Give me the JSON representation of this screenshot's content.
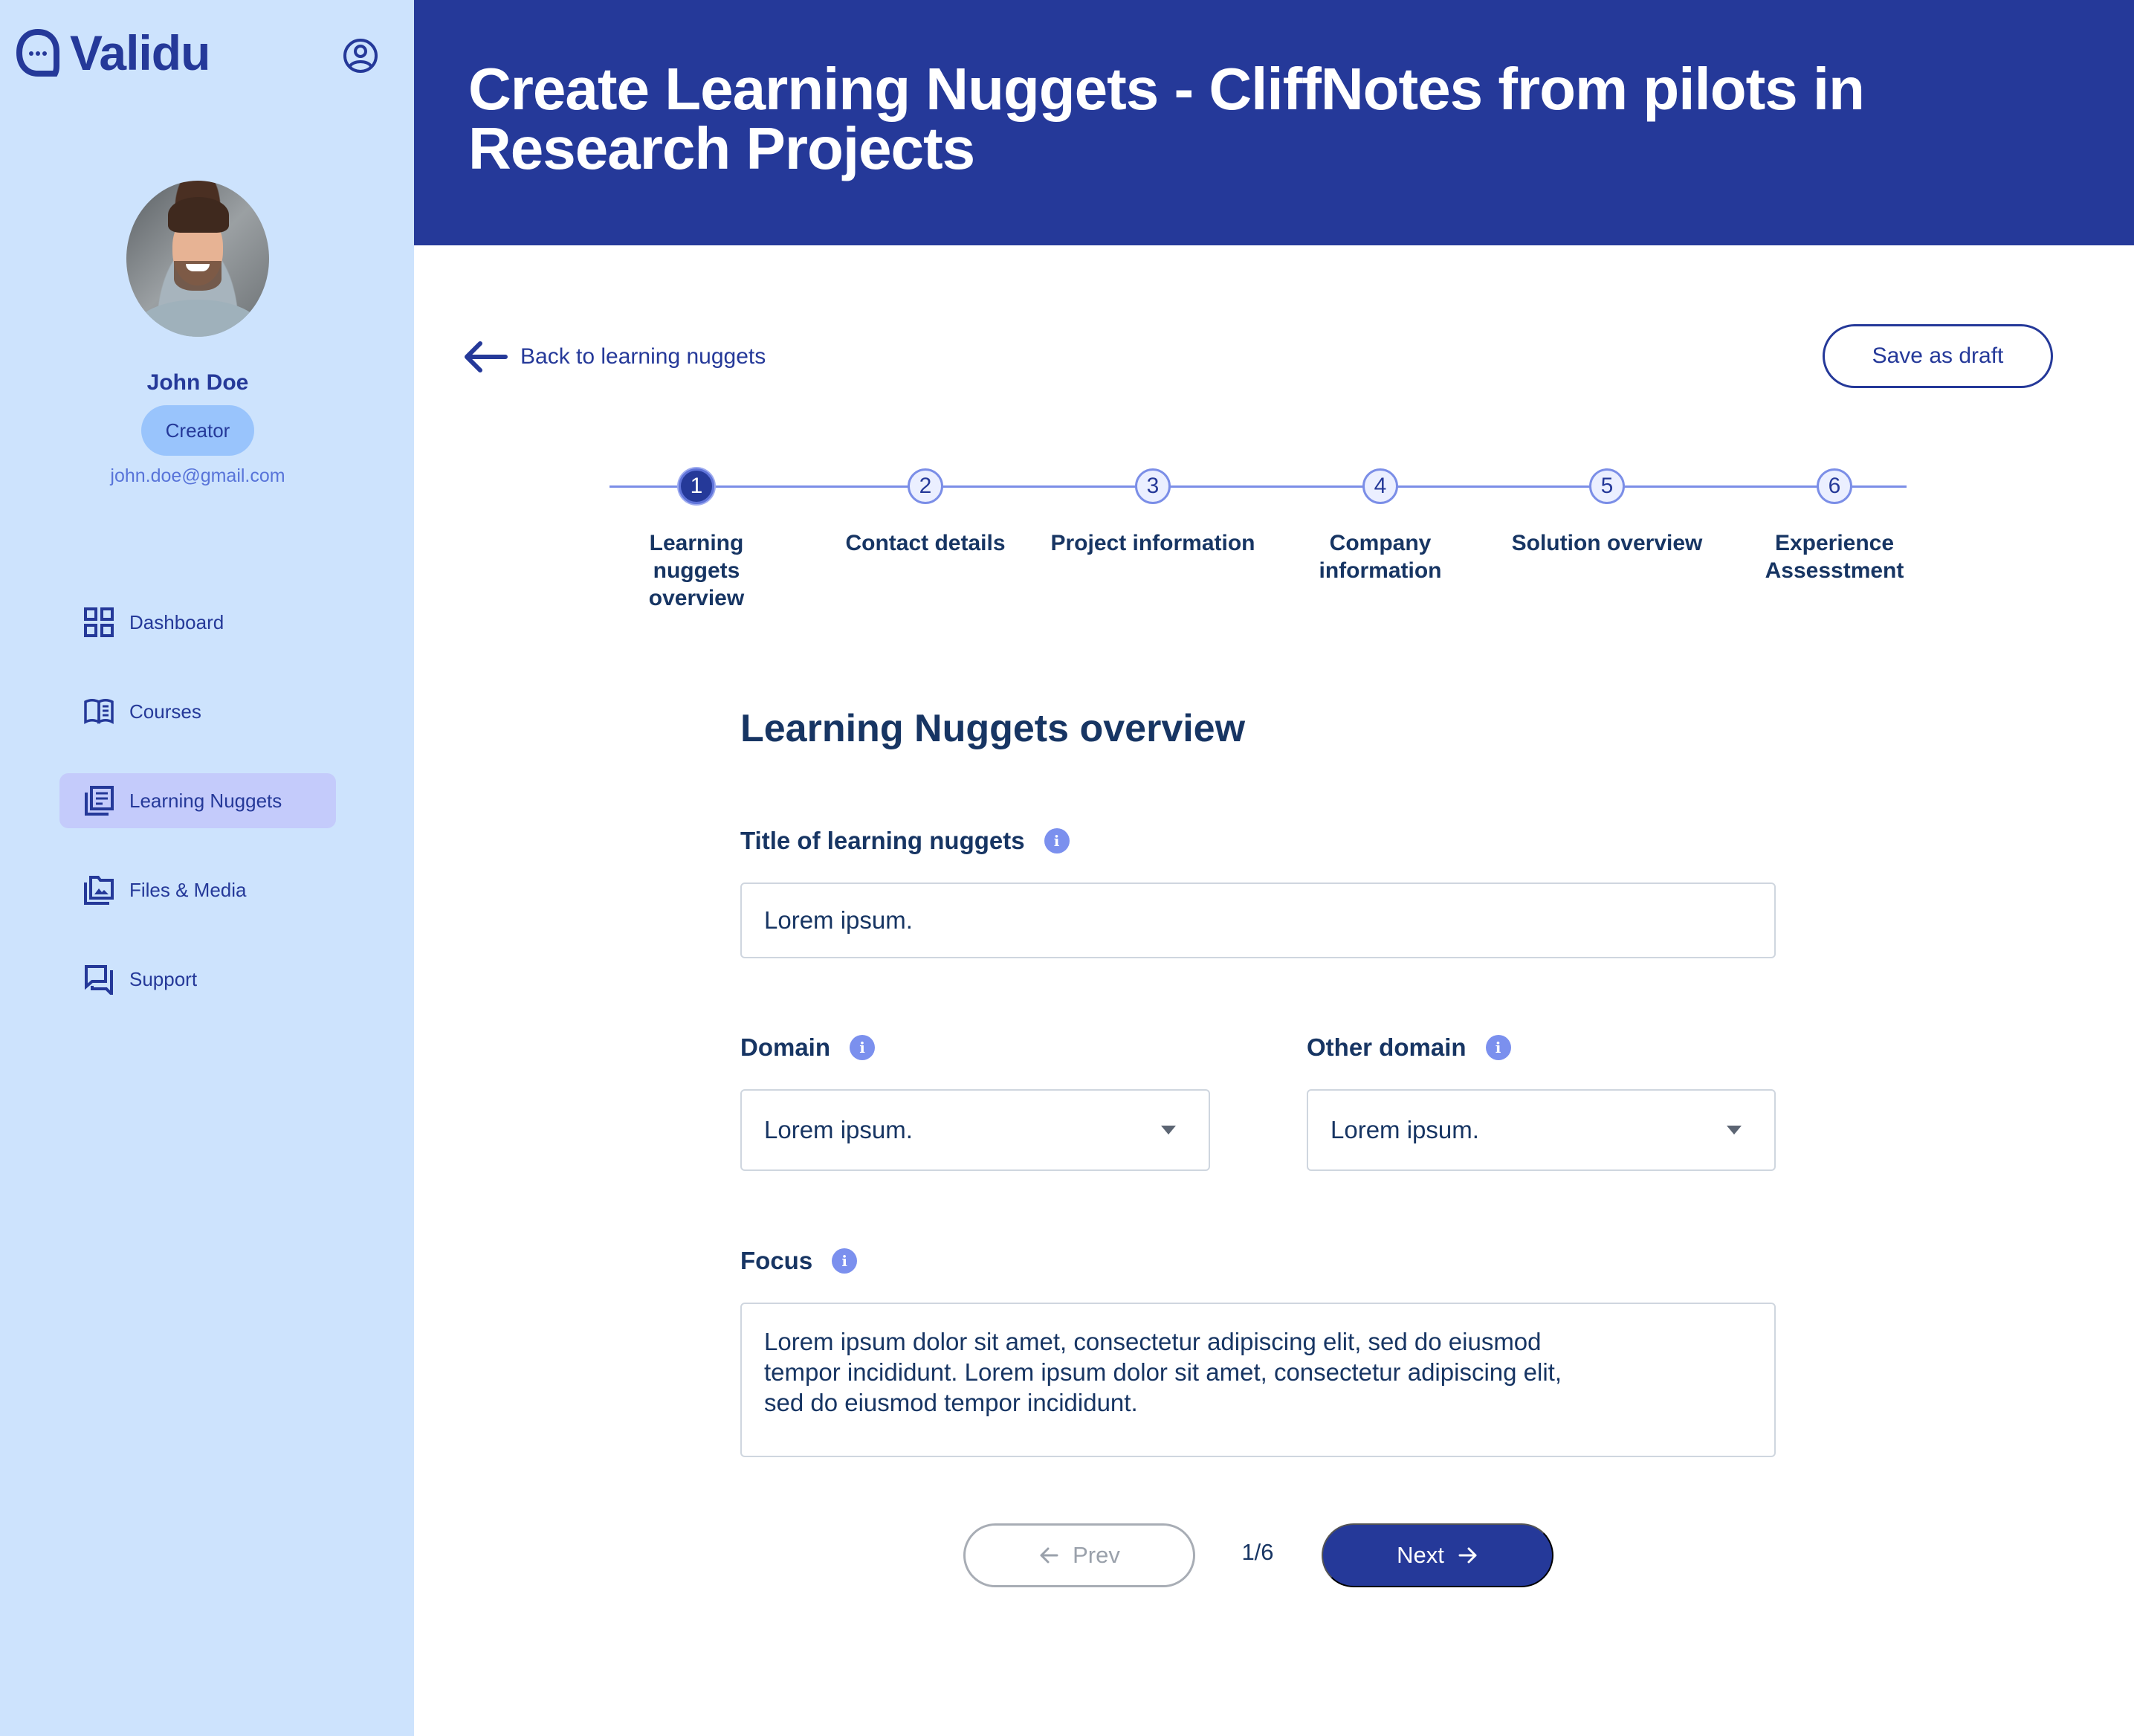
{
  "colors": {
    "brand_navy": "#253999",
    "sidebar_bg": "#cde3fd",
    "active_nav_bg": "#c4cbfb",
    "badge_bg": "#99c4fc",
    "text_dark": "#173563",
    "info_icon": "#7b90ee",
    "step_line": "#7b8ee7"
  },
  "sidebar": {
    "logo_text": "Validu",
    "user": {
      "name": "John Doe",
      "role": "Creator",
      "email": "john.doe@gmail.com"
    },
    "nav": [
      {
        "label": "Dashboard",
        "icon": "dashboard-grid-icon",
        "active": false
      },
      {
        "label": "Courses",
        "icon": "open-book-icon",
        "active": false
      },
      {
        "label": "Learning Nuggets",
        "icon": "document-stack-icon",
        "active": true
      },
      {
        "label": "Files & Media",
        "icon": "image-folder-icon",
        "active": false
      },
      {
        "label": "Support",
        "icon": "chat-bubbles-icon",
        "active": false
      }
    ]
  },
  "header": {
    "title": "Create Learning Nuggets - CliffNotes from pilots in Research Projects"
  },
  "actions": {
    "back_label": "Back to learning nuggets",
    "save_draft_label": "Save as draft"
  },
  "stepper": {
    "current": 1,
    "steps": [
      {
        "number": "1",
        "label": "Learning nuggets overview"
      },
      {
        "number": "2",
        "label": "Contact details"
      },
      {
        "number": "3",
        "label": "Project information"
      },
      {
        "number": "4",
        "label": "Company information"
      },
      {
        "number": "5",
        "label": "Solution overview"
      },
      {
        "number": "6",
        "label": "Experience Assesstment"
      }
    ]
  },
  "form": {
    "section_title": "Learning Nuggets overview",
    "title_field": {
      "label": "Title of learning nuggets",
      "value": "Lorem ipsum."
    },
    "domain_field": {
      "label": "Domain",
      "value": "Lorem ipsum."
    },
    "other_domain_field": {
      "label": "Other domain",
      "value": "Lorem ipsum."
    },
    "focus_field": {
      "label": "Focus",
      "value": "Lorem ipsum dolor sit amet, consectetur adipiscing elit, sed do eiusmod tempor incididunt. Lorem ipsum dolor sit amet, consectetur adipiscing elit, sed do eiusmod tempor incididunt."
    },
    "info_glyph": "i"
  },
  "pagination": {
    "prev_label": "Prev",
    "next_label": "Next",
    "indicator": "1/6"
  }
}
